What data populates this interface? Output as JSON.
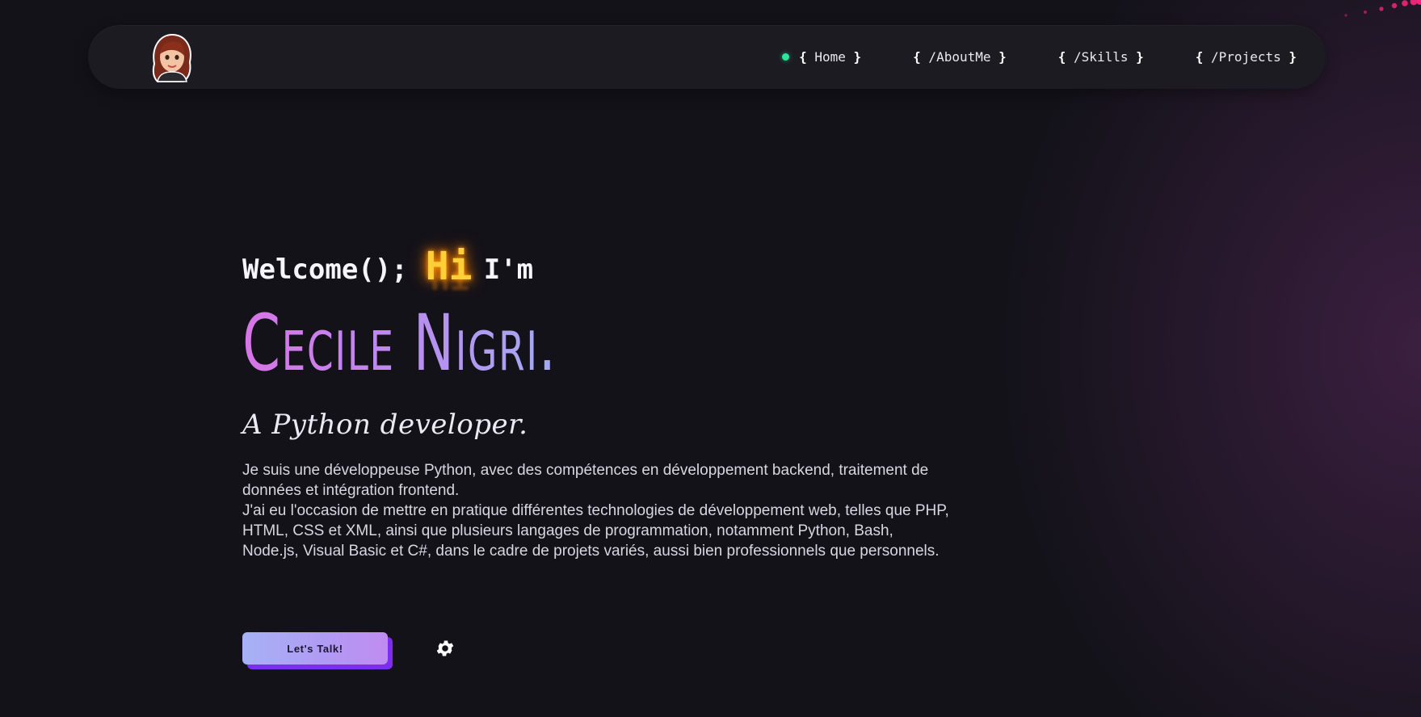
{
  "nav": {
    "avatar_icon": "avatar-illustration",
    "items": [
      {
        "open": "{",
        "label": " Home ",
        "close": "}",
        "active": true
      },
      {
        "open": "{",
        "label": " /AboutMe ",
        "close": "}",
        "active": false
      },
      {
        "open": "{",
        "label": " /Skills ",
        "close": "}",
        "active": false
      },
      {
        "open": "{",
        "label": " /Projects ",
        "close": "}",
        "active": false
      }
    ],
    "active_color": "#2fe39a"
  },
  "hero": {
    "welcome_prefix": "Welcome();",
    "neon_text": "Hi",
    "welcome_suffix": "I'm",
    "name": "Cecile Nigri.",
    "role": "A Python developer.",
    "bio_lines": [
      "Je suis une développeuse Python, avec des compétences en développement backend, traitement de données et intégration frontend.",
      "J'ai eu l'occasion de mettre en pratique différentes technologies de développement web, telles que PHP, HTML, CSS et XML, ainsi que plusieurs langages de programmation, notamment Python, Bash, Node.js, Visual Basic et C#, dans le cadre de projets variés, aussi bien professionnels que personnels."
    ]
  },
  "actions": {
    "talk_label": "Let's Talk!",
    "settings_icon": "gear-icon"
  },
  "colors": {
    "background": "#131219",
    "navbar": "#1c1b22",
    "name_gradient_start": "#d774e6",
    "name_gradient_end": "#9db4f2",
    "button_shadow": "#7b2df0",
    "neon": "#ffcf3a"
  }
}
